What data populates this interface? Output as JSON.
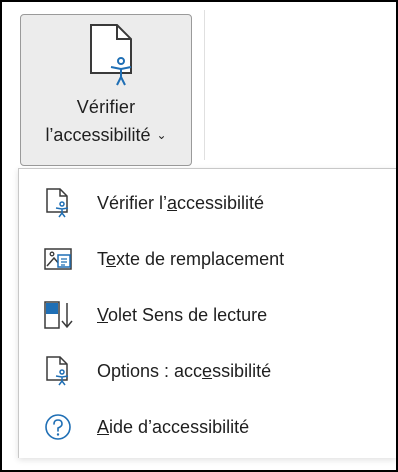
{
  "ribbon": {
    "button": {
      "label_line1": "Vérifier",
      "label_line2": "l’accessibilité",
      "chevron": "⌄",
      "icon": "accessibility-document-icon"
    }
  },
  "menu": {
    "items": [
      {
        "pre": "Vérifier l’",
        "accel": "a",
        "post": "ccessibilité",
        "icon": "accessibility-check-icon"
      },
      {
        "pre": "T",
        "accel": "e",
        "post": "xte de remplacement",
        "icon": "alt-text-icon"
      },
      {
        "pre": "",
        "accel": "V",
        "post": "olet Sens de lecture",
        "icon": "reading-order-pane-icon"
      },
      {
        "pre": "Options : acc",
        "accel": "e",
        "post": "ssibilité",
        "icon": "accessibility-options-icon"
      },
      {
        "pre": "",
        "accel": "A",
        "post": "ide d’accessibilité",
        "icon": "help-icon"
      }
    ]
  },
  "colors": {
    "accent_blue": "#1f6fb5",
    "icon_dark": "#3a3a3a",
    "button_bg": "#ececec"
  }
}
